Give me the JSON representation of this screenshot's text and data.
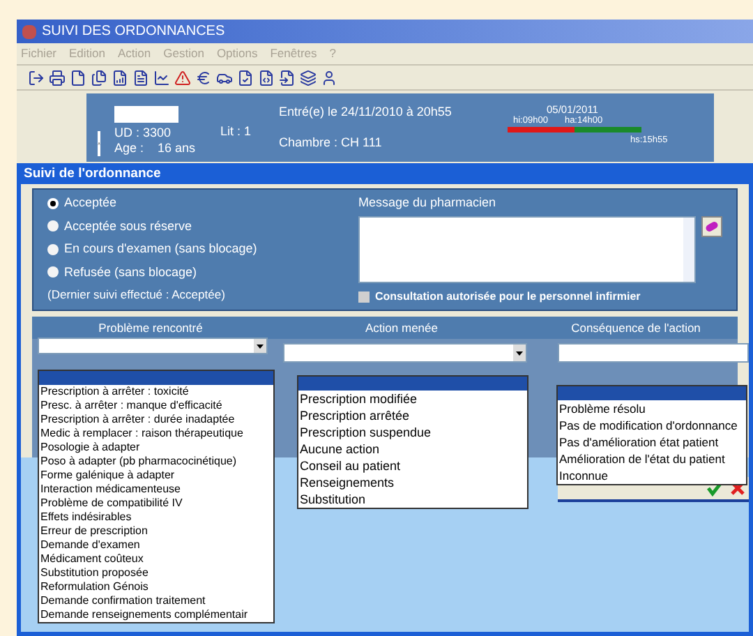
{
  "window": {
    "title": "SUIVI DES ORDONNANCES"
  },
  "menu": [
    "Fichier",
    "Edition",
    "Action",
    "Gestion",
    "Options",
    "Fenêtres",
    "?"
  ],
  "patient": {
    "ud": "UD : 3300",
    "age": "Age :    16 ans",
    "lit": "Lit : 1",
    "entree": "Entré(e) le 24/11/2010 à 20h55",
    "chambre": "Chambre : CH 111",
    "date": "05/01/2011",
    "time_1": "hi:09h00",
    "time_2": "ha:14h00",
    "time_3": "hs:15h55"
  },
  "dialog": {
    "title": "Suivi de l'ordonnance",
    "statuses": [
      {
        "label": "Acceptée",
        "selected": true
      },
      {
        "label": "Acceptée sous réserve",
        "selected": false
      },
      {
        "label": "En cours d'examen (sans blocage)",
        "selected": false
      },
      {
        "label": "Refusée (sans blocage)",
        "selected": false
      }
    ],
    "last_follow_up": "(Dernier suivi effectué : Acceptée)",
    "message_label": "Message du pharmacien",
    "nurse_access": {
      "label": "Consultation autorisée pour le personnel infirmier",
      "checked": false
    },
    "columns": [
      "Problème rencontré",
      "Action menée",
      "Conséquence de l'action"
    ],
    "problem_options": [
      "Prescription à arrêter : toxicité",
      "Presc. à arrêter : manque d'efficacité",
      "Prescription à arrêter : durée inadaptée",
      "Medic à remplacer : raison thérapeutique",
      "Posologie à adapter",
      "Poso à adapter (pb pharmacocinétique)",
      "Forme galénique à adapter",
      "Interaction médicamenteuse",
      "Problème de compatibilité IV",
      "Effets indésirables",
      "Erreur de prescription",
      "Demande d'examen",
      "Médicament coûteux",
      "Substitution proposée",
      "Reformulation Génois",
      "Demande confirmation traitement",
      "Demande renseignements complémentair"
    ],
    "action_options": [
      "Prescription modifiée",
      "Prescription arrêtée",
      "Prescription suspendue",
      "Aucune action",
      "Conseil au patient",
      "Renseignements",
      "Substitution"
    ],
    "consequence_options": [
      "Problème résolu",
      "Pas de modification d'ordonnance",
      "Pas d'amélioration état patient",
      "Amélioration de l'état du patient",
      "Inconnue"
    ]
  }
}
